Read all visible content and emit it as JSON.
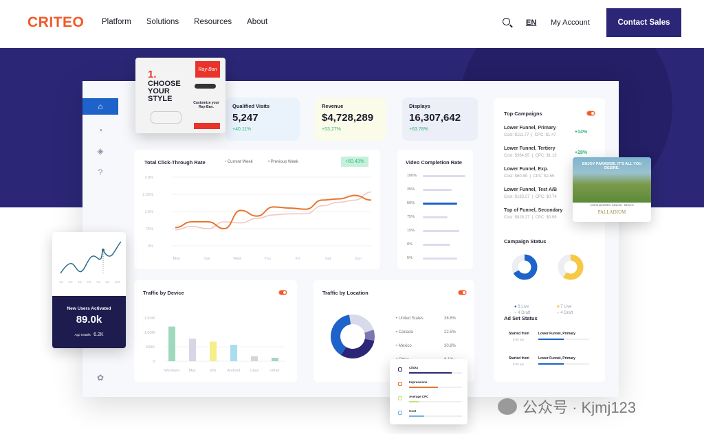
{
  "header": {
    "logo": "CRITEO",
    "nav": [
      "Platform",
      "Solutions",
      "Resources",
      "About"
    ],
    "lang": "EN",
    "account": "My Account",
    "cta": "Contact Sales"
  },
  "kpis": [
    {
      "label": "Qualified Visits",
      "value": "5,247",
      "change": "+40.11%",
      "bg": "#eaf3fc"
    },
    {
      "label": "Revenue",
      "value": "$4,728,289",
      "change": "+53.27%",
      "bg": "#fbfbea"
    },
    {
      "label": "Displays",
      "value": "16,307,642",
      "change": "+63.78%",
      "bg": "#eceef8"
    }
  ],
  "ctr": {
    "title": "Total Click-Through Rate",
    "legend": [
      "Current Week",
      "Previous Week"
    ],
    "badge": "+60.43%"
  },
  "chart_data": [
    {
      "type": "line",
      "title": "Total Click-Through Rate",
      "categories": [
        "Mon",
        "Tue",
        "Wed",
        "Thu",
        "Fri",
        "Sat",
        "Sun"
      ],
      "yticks": [
        "0%",
        "75%",
        "1.5%",
        "2.25%",
        "3.0%"
      ],
      "ylim": [
        0,
        3.0
      ],
      "grid": true,
      "legend": "top",
      "series": [
        {
          "name": "Current Week",
          "color": "#e8742e",
          "values": [
            0.8,
            1.05,
            1.05,
            0.75,
            1.55,
            1.3,
            1.7,
            1.65,
            1.6,
            2.0,
            2.05,
            2.2,
            2.0
          ]
        },
        {
          "name": "Previous Week",
          "color": "#f2c4bb",
          "values": [
            0.7,
            0.85,
            0.75,
            1.05,
            1.0,
            1.2,
            1.35,
            1.4,
            1.4,
            1.75,
            1.9,
            2.0,
            2.35
          ]
        }
      ]
    },
    {
      "type": "bar",
      "title": "Traffic by Device",
      "categories": [
        "Windows",
        "Mac",
        "iOS",
        "Android",
        "Linux",
        "Other"
      ],
      "values": [
        1.2,
        0.78,
        0.68,
        0.57,
        0.17,
        0.12
      ],
      "yticks": [
        "0",
        "500K",
        "1.00M",
        "1.50M"
      ],
      "ylim": [
        0,
        1.5
      ],
      "colors": [
        "#9fd8bd",
        "#d6d6e6",
        "#f6ee8a",
        "#a8def0",
        "#d5d5da",
        "#9fd8bd"
      ]
    },
    {
      "type": "pie",
      "title": "Traffic by Location",
      "categories": [
        "United States",
        "Canada",
        "Mexico",
        "Other"
      ],
      "values": [
        38.6,
        22.5,
        30.8,
        8.1
      ],
      "labels": [
        "38.6%",
        "22.5%",
        "30.8%",
        "8.1%"
      ],
      "colors": [
        "#1d63c9",
        "#d8d9ea",
        "#2b2776",
        "#7b78b0"
      ]
    }
  ],
  "video": {
    "title": "Video Completion Rate",
    "rows": [
      {
        "label": "100%",
        "value": 100
      },
      {
        "label": "25%",
        "value": 68
      },
      {
        "label": "50%",
        "value": 80,
        "active": true
      },
      {
        "label": "75%",
        "value": 58
      },
      {
        "label": "15%",
        "value": 85
      },
      {
        "label": "0%",
        "value": 65
      },
      {
        "label": "5%",
        "value": 80
      }
    ]
  },
  "campaigns": {
    "title": "Top Campaigns",
    "items": [
      {
        "name": "Lower Funnel, Primary",
        "meta": "Cost: $111.77  |  CPC: $1.47",
        "change": "+14%"
      },
      {
        "name": "Lower Funnel, Tertiery",
        "meta": "Cost: $364.95  |  CPC: $1.13",
        "change": "+28%"
      },
      {
        "name": "Lower Funnel, Exp.",
        "meta": "Cost: $60.89  |  CPC: $2.65"
      },
      {
        "name": "Lower Funnel, Test A/B",
        "meta": "Cost: $183.27  |  CPC: $0.74"
      },
      {
        "name": "Top of Funnel, Secondary",
        "meta": "Cost: $828.27  |  CPC: $0.98"
      }
    ]
  },
  "campaign_status": {
    "title": "Campaign Status",
    "a": {
      "live": "8 Live",
      "draft": "4 Draft",
      "color": "#1d63c9",
      "fraction": 0.67
    },
    "b": {
      "live": "7 Live",
      "draft": "4 Draft",
      "color": "#f7c844",
      "fraction": 0.6
    }
  },
  "adset": {
    "title": "Ad Set Status",
    "rows": [
      {
        "started": "Started from",
        "time": "9:00 am",
        "name": "Lower Funnel, Primary",
        "progress": 0.5
      },
      {
        "started": "Started from",
        "time": "9:00 am",
        "name": "Lower Funnel, Primary",
        "progress": 0.5
      }
    ]
  },
  "device_title": "Traffic by Device",
  "location_title": "Traffic by Location",
  "ad_rayban": {
    "step": "1.",
    "headline": "CHOOSE YOUR STYLE",
    "sub": "Customize your Ray-Ban."
  },
  "ad_palladium": {
    "headline": "ENJOY PARADISE. IT'S ALL YOU DESIRE.",
    "location": "COSTA MUJERES, CANCUN · MEXICO",
    "brand": "PALLADIUM"
  },
  "new_users": {
    "xticks": [
      "1%",
      "2%",
      "4%",
      "5%",
      "7%",
      "8%",
      "10%"
    ],
    "title": "New Users Activated",
    "value": "89.0k",
    "sub_label": "App Installs",
    "sub_value": "6.2K"
  },
  "metrics": [
    {
      "label": "Clicks",
      "progress": 0.8,
      "color": "#2b2776"
    },
    {
      "label": "Impressions",
      "progress": 0.55,
      "color": "#e8742e"
    },
    {
      "label": "Average CPC",
      "progress": 0.18,
      "color": "#c9e07a"
    },
    {
      "label": "Cost",
      "progress": 0.28,
      "color": "#6fb3e0"
    }
  ],
  "watermark": "公众号 · Kjmj123"
}
